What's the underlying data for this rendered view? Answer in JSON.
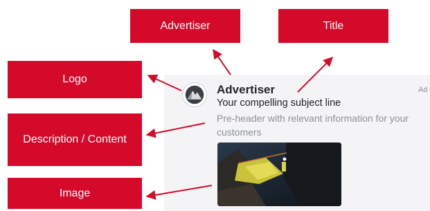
{
  "labels": {
    "advertiser": "Advertiser",
    "title": "Title",
    "logo": "Logo",
    "description": "Description / Content",
    "image": "Image"
  },
  "ad": {
    "advertiser_name": "Advertiser",
    "ad_tag": "Ad",
    "subject_line": "Your compelling subject line",
    "preheader": "Pre-header with relevant information for your customers",
    "logo_icon": "mountain-icon",
    "image_description": "rock-climbing-photo"
  },
  "colors": {
    "label_background": "#d50a2a",
    "label_text": "#ffffff",
    "arrow": "#d50a2a",
    "card_background": "#f4f4f6"
  }
}
